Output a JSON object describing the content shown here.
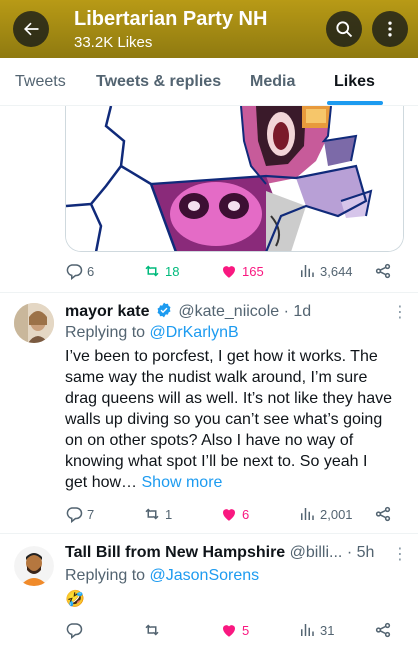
{
  "header": {
    "title": "Libertarian Party NH",
    "subtitle": "33.2K Likes"
  },
  "tabs": [
    {
      "label": "Tweets"
    },
    {
      "label": "Tweets & replies"
    },
    {
      "label": "Media"
    },
    {
      "label": "Likes"
    }
  ],
  "tweets": [
    {
      "actions": {
        "replies": "6",
        "retweets": "18",
        "likes": "165",
        "views": "3,644"
      }
    },
    {
      "name": "mayor kate",
      "handle": "@kate_niicole",
      "time": "· 1d",
      "replying_prefix": "Replying to",
      "replying_to": "@DrKarlynB",
      "text_lines": [
        "I’ve been to porcfest, I get how it works. The",
        "same way the nudist walk around, I’m sure",
        "drag queens will as well. It’s not like they have",
        "walls up diving so you can’t see what’s going",
        "on on other spots? Also I have no way of",
        "knowing what spot I’ll be next to. So yeah I"
      ],
      "text_last": "get how…",
      "show_more": "Show more",
      "actions": {
        "replies": "7",
        "retweets": "1",
        "likes": "6",
        "views": "2,001"
      }
    },
    {
      "name": "Tall Bill from New Hampshire",
      "handle": "@billi...",
      "time": "· 5h",
      "replying_prefix": "Replying to",
      "replying_to": "@JasonSorens",
      "text": "🤣",
      "actions": {
        "replies": "",
        "retweets": "",
        "likes": "5",
        "views": "31"
      }
    }
  ],
  "colors": {
    "header_bg": "#a98d14",
    "accent": "#1d9bf0",
    "retweet_green": "#00ba7c",
    "like_pink": "#f91880"
  }
}
